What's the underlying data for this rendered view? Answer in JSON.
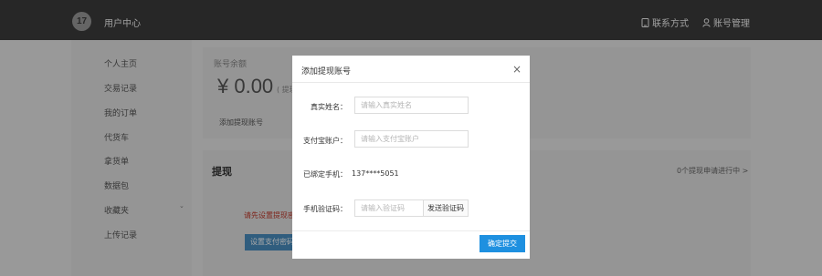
{
  "header": {
    "logo_text": "17",
    "title": "用户中心",
    "contact_label": "联系方式",
    "account_label": "账号管理"
  },
  "sidebar": {
    "items": [
      {
        "label": "个人主页"
      },
      {
        "label": "交易记录"
      },
      {
        "label": "我的订单"
      },
      {
        "label": "代货车"
      },
      {
        "label": "拿货单"
      },
      {
        "label": "数据包"
      },
      {
        "label": "收藏夹"
      },
      {
        "label": "上传记录"
      }
    ]
  },
  "balance": {
    "label": "账号余额",
    "value": "¥ 0.00",
    "hint": "( 提现",
    "add_account_link": "添加提现账号"
  },
  "withdraw": {
    "title": "提现",
    "progress": "0个提现申请进行中 >",
    "warning": "请先设置提现密",
    "set_pay_button": "设置支付密码"
  },
  "modal": {
    "title": "添加提现账号",
    "close_symbol": "×",
    "real_name_label": "真实姓名：",
    "real_name_placeholder": "请输入真实姓名",
    "alipay_label": "支付宝账户：",
    "alipay_placeholder": "请输入支付宝账户",
    "phone_label": "已绑定手机：",
    "phone_value": "137****5051",
    "code_label": "手机验证码：",
    "code_placeholder": "请输入验证码",
    "send_code_button": "发送验证码",
    "submit_button": "确定提交"
  },
  "colors": {
    "header_bg": "#3c3c3c",
    "primary_button": "#1e90e0",
    "warning_text": "#c0392b"
  }
}
